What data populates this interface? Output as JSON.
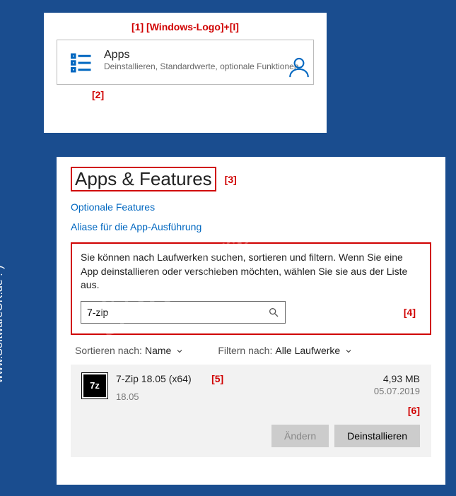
{
  "watermark": "SoftwareOk.de",
  "side_text": "www.SoftwareOK.de :-)",
  "annotations": {
    "a1": "[1] [Windows-Logo]+[I]",
    "a2": "[2]",
    "a3": "[3]",
    "a4": "[4]",
    "a5": "[5]",
    "a6": "[6]"
  },
  "tile": {
    "title": "Apps",
    "subtitle": "Deinstallieren, Standardwerte, optionale Funktionen"
  },
  "main": {
    "heading": "Apps & Features",
    "link1": "Optionale Features",
    "link2": "Aliase für die App-Ausführung",
    "description": "Sie können nach Laufwerken suchen, sortieren und filtern. Wenn Sie eine App deinstallieren oder verschieben möchten, wählen Sie sie aus der Liste aus.",
    "search_value": "7-zip",
    "sort_label": "Sortieren nach:",
    "sort_value": "Name",
    "filter_label": "Filtern nach:",
    "filter_value": "Alle Laufwerke"
  },
  "app": {
    "icon_text": "7z",
    "name": "7-Zip 18.05 (x64)",
    "version": "18.05",
    "size": "4,93 MB",
    "date": "05.07.2019",
    "btn_modify": "Ändern",
    "btn_uninstall": "Deinstallieren"
  }
}
